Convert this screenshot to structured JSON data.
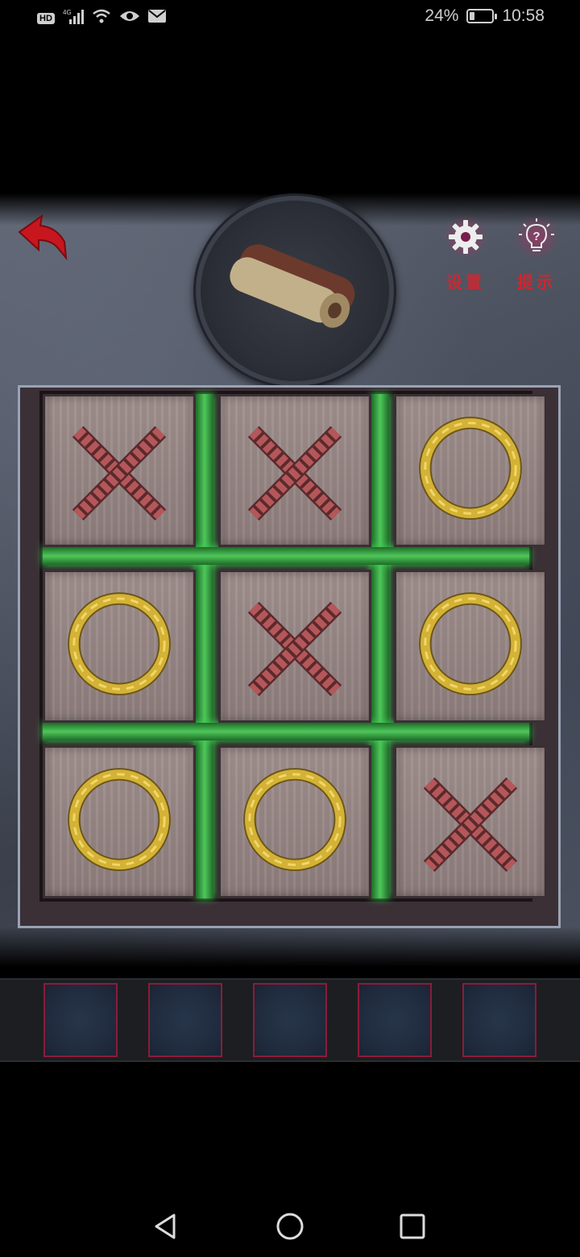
{
  "status_bar": {
    "hd_label": "HD",
    "network_label": "4G",
    "battery_percent": "24%",
    "battery_level": 0.24,
    "time": "10:58"
  },
  "top_bar": {
    "settings_label": "设置",
    "hint_label": "提示",
    "accent_color": "#d1262e"
  },
  "board": {
    "cells": [
      "X",
      "X",
      "O",
      "O",
      "X",
      "O",
      "O",
      "O",
      "X"
    ],
    "x_color": "#b5575a",
    "o_color": "#d4b236",
    "grid_glow_color": "#3ecf52"
  },
  "inventory": {
    "slots": [
      "empty",
      "empty",
      "empty",
      "empty",
      "empty"
    ]
  }
}
